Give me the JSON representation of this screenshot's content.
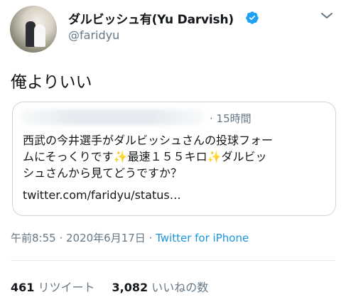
{
  "author": {
    "display_name": "ダルビッシュ有(Yu Darvish)",
    "handle": "@faridyu",
    "verified": true
  },
  "tweet": {
    "text": "俺よりいい"
  },
  "quoted_tweet": {
    "time": "· 15時間",
    "lines": [
      "西武の今井選手がダルビッシュさんの投球フォー",
      "ムにそっくりです✨最速１５５キロ✨ダルビッ",
      "シュさんから見てどうですか？"
    ],
    "link": "twitter.com/faridyu/status…"
  },
  "meta": {
    "timestamp": "午前8:55 · 2020年6月17日",
    "separator": " · ",
    "source": "Twitter for iPhone"
  },
  "stats": {
    "retweets_count": "461",
    "retweets_label": "リツイート",
    "likes_count": "3,082",
    "likes_label": "いいねの数"
  },
  "icons": {
    "verified": "verified-badge-icon",
    "more": "chevron-down-icon"
  },
  "colors": {
    "accent": "#1b95e0",
    "muted": "#657786",
    "text": "#14171a",
    "border": "#ccd6dd"
  }
}
